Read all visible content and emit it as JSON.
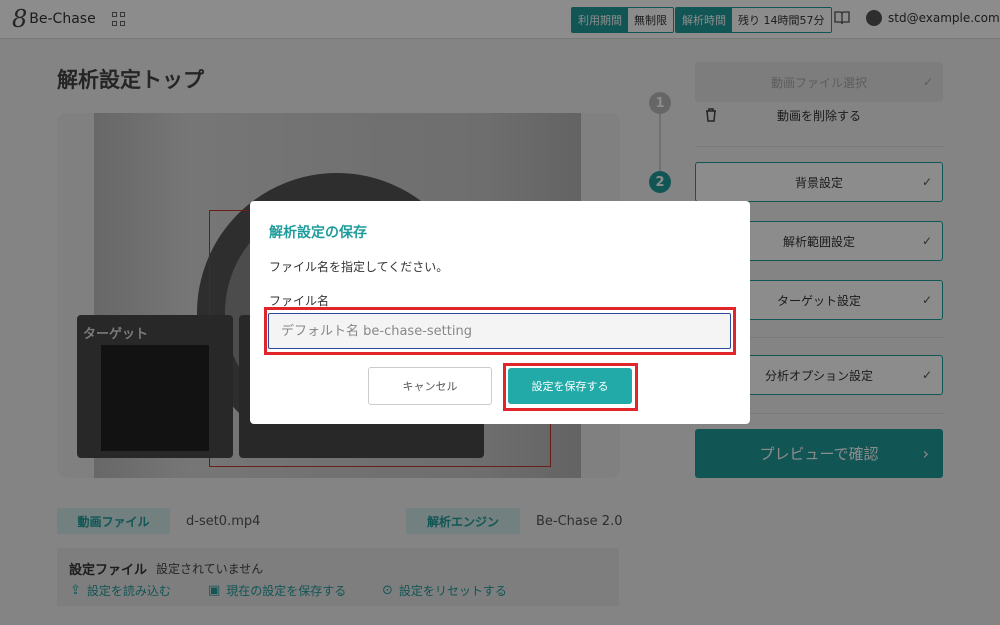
{
  "app": {
    "name": "Be-Chase",
    "logo_mark": "8"
  },
  "header": {
    "usage_period_label": "利用期間",
    "usage_period_value": "無制限",
    "analysis_time_label": "解析時間",
    "analysis_time_value": "残り 14時間57分",
    "user_email": "std@example.com"
  },
  "page": {
    "title": "解析設定トップ"
  },
  "preview": {
    "target_title": "ターゲット"
  },
  "steps": {
    "step1": "1",
    "step2": "2"
  },
  "sidebar": {
    "select_video": "動画ファイル選択",
    "delete_video": "動画を削除する",
    "background": "背景設定",
    "analysis_range": "解析範囲設定",
    "target": "ターゲット設定",
    "analysis_options": "分析オプション設定",
    "preview_confirm": "プレビューで確認",
    "check": "✓",
    "arrow": "›"
  },
  "bottom": {
    "video_file_label": "動画ファイル",
    "video_file_value": "d-set0.mp4",
    "engine_label": "解析エンジン",
    "engine_value": "Be-Chase 2.0",
    "settings_file_label": "設定ファイル",
    "settings_file_value": "設定されていません",
    "load_settings": "設定を読み込む",
    "save_current": "現在の設定を保存する",
    "reset_settings": "設定をリセットする"
  },
  "modal": {
    "title": "解析設定の保存",
    "description": "ファイル名を指定してください。",
    "field_label": "ファイル名",
    "input_placeholder": "デフォルト名 be-chase-setting",
    "input_value": "",
    "cancel": "キャンセル",
    "save": "設定を保存する"
  },
  "colors": {
    "accent": "#1f9c9c",
    "highlight": "#e0252b"
  },
  "icons": [
    "grid-icon",
    "book-icon",
    "user-icon",
    "trash-icon",
    "upload-icon",
    "save-icon",
    "reset-icon",
    "check-icon",
    "chevron-right-icon"
  ]
}
